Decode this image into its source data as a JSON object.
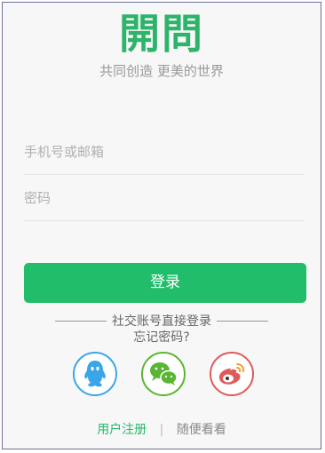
{
  "header": {
    "logo_text": "開問",
    "slogan": "共同创造 更美的世界"
  },
  "form": {
    "account_placeholder": "手机号或邮箱",
    "password_placeholder": "密码",
    "login_label": "登录"
  },
  "social": {
    "divider_text": "社交账号直接登录",
    "forgot_label": "忘记密码?",
    "items": [
      {
        "name": "qq-icon",
        "color": "#3aa6e8"
      },
      {
        "name": "wechat-icon",
        "color": "#5ab533"
      },
      {
        "name": "weibo-icon",
        "color": "#e05a5a"
      }
    ]
  },
  "footer": {
    "register_label": "用户注册",
    "separator": "|",
    "browse_label": "随便看看"
  }
}
